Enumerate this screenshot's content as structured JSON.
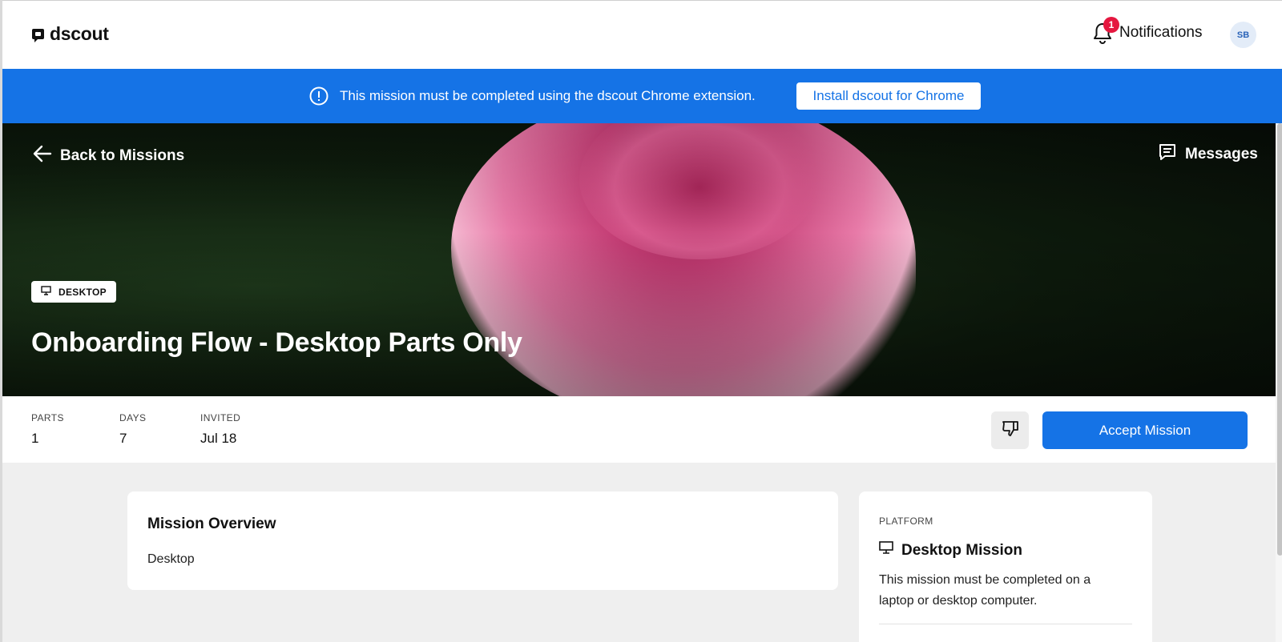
{
  "header": {
    "brand": "dscout",
    "notifications_label": "Notifications",
    "notifications_count": "1",
    "avatar_initials": "SB"
  },
  "banner": {
    "message": "This mission must be completed using the dscout Chrome extension.",
    "button_label": "Install dscout for Chrome"
  },
  "hero": {
    "back_label": "Back to Missions",
    "messages_label": "Messages",
    "platform_chip": "DESKTOP",
    "title": "Onboarding Flow - Desktop Parts Only"
  },
  "stats": [
    {
      "label": "PARTS",
      "value": "1"
    },
    {
      "label": "DAYS",
      "value": "7"
    },
    {
      "label": "INVITED",
      "value": "Jul 18"
    }
  ],
  "actions": {
    "decline_icon": "thumbs-down-icon",
    "accept_label": "Accept Mission"
  },
  "overview": {
    "title": "Mission Overview",
    "body": "Desktop"
  },
  "platform": {
    "label": "PLATFORM",
    "title": "Desktop Mission",
    "description": "This mission must be completed on a laptop or desktop computer."
  },
  "colors": {
    "accent": "#1573e6",
    "badge": "#e5173f",
    "background": "#efefef"
  }
}
